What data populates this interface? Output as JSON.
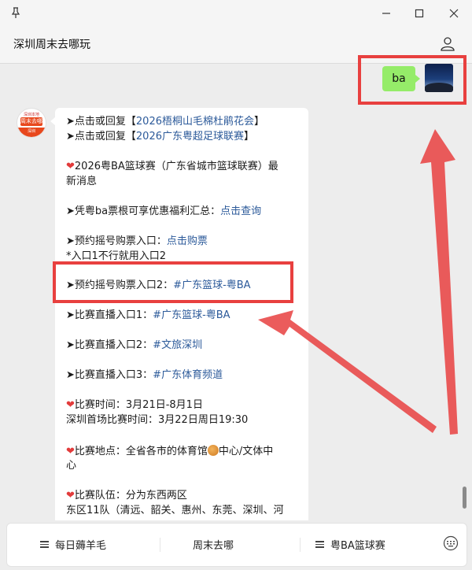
{
  "window": {
    "pin_icon": "pin-icon",
    "minimize_icon": "minimize-icon",
    "maximize_icon": "maximize-icon",
    "close_icon": "close-icon"
  },
  "header": {
    "title": "深圳周末去哪玩",
    "user_icon": "person-icon"
  },
  "chat": {
    "my_message": "ba",
    "bot_avatar": {
      "top": "深圳本地",
      "middle": "周末去哪",
      "bottom": "深圳"
    },
    "lines": {
      "l1_pre": "➤点击或回复【",
      "l1_link": "2026梧桐山毛棉杜鹃花会",
      "l1_post": "】",
      "l2_pre": "➤点击或回复【",
      "l2_link": "2026广东粤超足球联赛",
      "l2_post": "】",
      "l3_text": "2026粤BA篮球赛（广东省城市篮球联赛）最",
      "l4_text": "新消息",
      "l5_pre": "➤凭粤ba票根可享优惠福利汇总：",
      "l5_link": "点击查询",
      "l6_pre": "➤预约摇号购票入口：",
      "l6_link": "点击购票",
      "l7_text": "*入口1不行就用入口2",
      "l8_pre": "➤预约摇号购票入口2：",
      "l8_link": "#广东篮球-粤BA",
      "l9_pre": "➤比赛直播入口1：",
      "l9_link": "#广东篮球-粤BA",
      "l10_pre": "➤比赛直播入口2：",
      "l10_link": "#文旅深圳",
      "l11_pre": "➤比赛直播入口3：",
      "l11_link": "#广东体育频道",
      "l12_text": "比赛时间：3月21日-8月1日",
      "l13_text": "深圳首场比赛时间：3月22日周日19:30",
      "l14_pre": "比赛地点：全省各市的体育馆",
      "l14_post": "中心/文体中",
      "l15_text": "心",
      "l16_text": "比赛队伍：分为东西两区",
      "l17_text": "东区11队（清远、韶关、惠州、东莞、深圳、河"
    }
  },
  "menu": {
    "item1": "每日薅羊毛",
    "item2": "周末去哪",
    "item3": "粤BA篮球赛",
    "keyboard_icon": "keyboard-icon"
  },
  "colors": {
    "accent_link": "#2c5a9a",
    "annotation": "#e8403f",
    "my_bubble": "#95ec69"
  }
}
